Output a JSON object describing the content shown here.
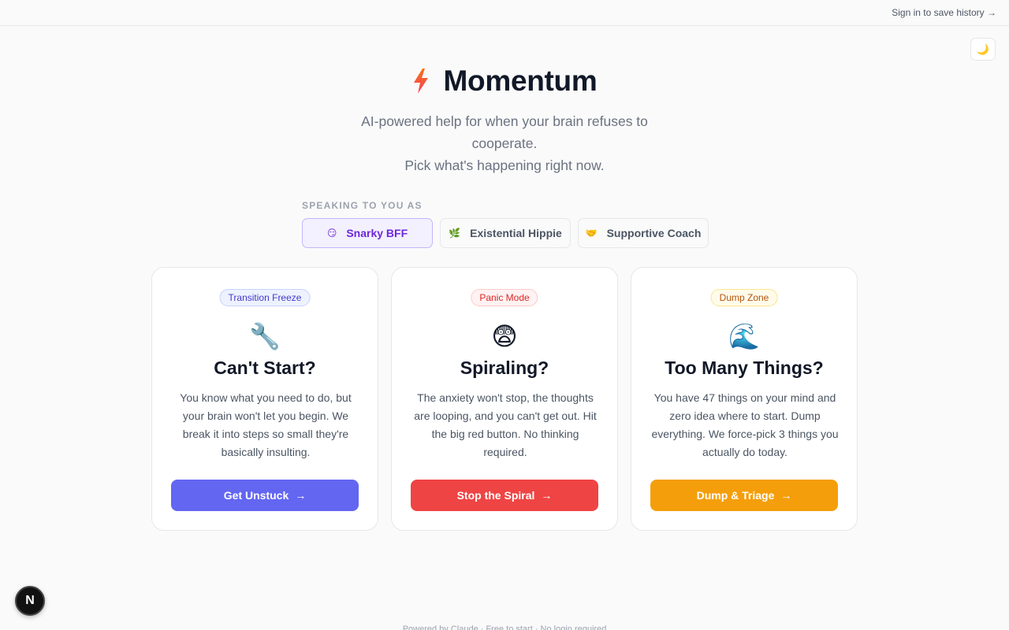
{
  "topbar": {
    "signin_label": "Sign in to save history →"
  },
  "theme_toggle": {
    "icon": "moon-icon",
    "glyph": "🌙"
  },
  "hero": {
    "title": "Momentum",
    "subtitle_line1": "AI-powered help for when your brain refuses to cooperate.",
    "subtitle_line2": "Pick what's happening right now.",
    "accent_colors": [
      "#f97316",
      "#f43f5e"
    ]
  },
  "personas": {
    "label": "SPEAKING TO YOU AS",
    "items": [
      {
        "emoji": "😏",
        "label": "Snarky BFF",
        "active": true
      },
      {
        "emoji": "🌿",
        "label": "Existential Hippie",
        "active": false
      },
      {
        "emoji": "🤝",
        "label": "Supportive Coach",
        "active": false
      }
    ]
  },
  "cards": [
    {
      "badge": "Transition Freeze",
      "emoji": "🔧",
      "title": "Can't Start?",
      "description": "You know what you need to do, but your brain won't let you begin. We break it into steps so small they're basically insulting.",
      "cta": "Get Unstuck",
      "arrow": "→",
      "color": "#6366f1"
    },
    {
      "badge": "Panic Mode",
      "emoji": "😨",
      "title": "Spiraling?",
      "description": "The anxiety won't stop, the thoughts are looping, and you can't get out. Hit the big red button. No thinking required.",
      "cta": "Stop the Spiral",
      "arrow": "→",
      "color": "#ef4444"
    },
    {
      "badge": "Dump Zone",
      "emoji": "🌊",
      "title": "Too Many Things?",
      "description": "You have 47 things on your mind and zero idea where to start. Dump everything. We force-pick 3 things you actually do today.",
      "cta": "Dump & Triage",
      "arrow": "→",
      "color": "#f59e0b"
    }
  ],
  "dev_indicator": {
    "label": "N"
  },
  "footer": {
    "text": "Powered by Claude · Free to start · No login required"
  }
}
